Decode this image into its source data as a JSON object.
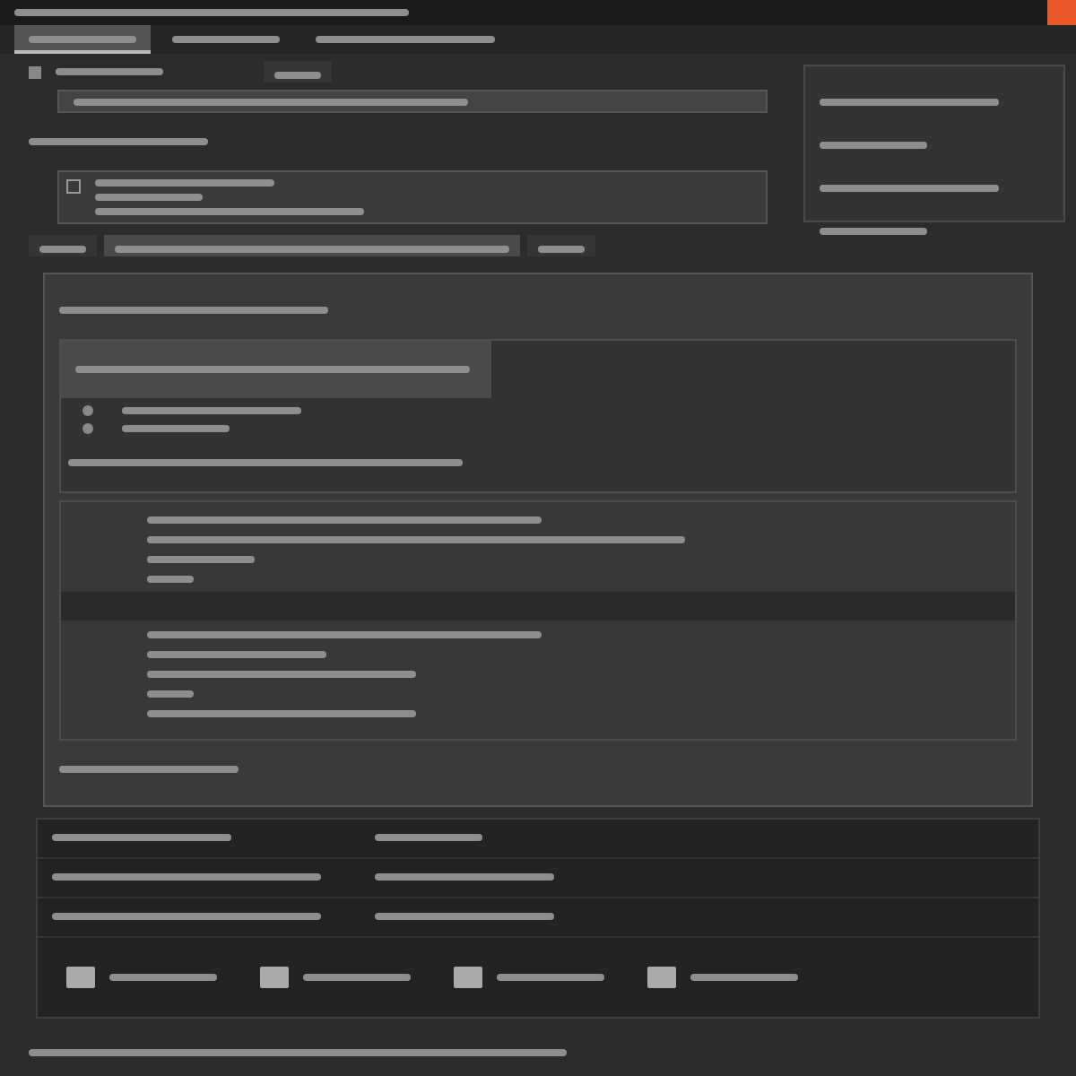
{
  "title_bar": {
    "text": {
      "kind": "xl"
    },
    "badge": {
      "kind": "alert"
    }
  },
  "tabs": [
    {
      "kind": "s",
      "selected": true
    },
    {
      "kind": "s",
      "selected": false
    },
    {
      "kind": "m",
      "selected": false
    }
  ],
  "header": {
    "text": {
      "kind": "s"
    },
    "button": {
      "kind": "xs"
    }
  },
  "search": {
    "text": {
      "kind": "xl"
    }
  },
  "note": {
    "kind": "m"
  },
  "task_card": {
    "checked": false,
    "lines": [
      {
        "kind": "m"
      },
      {
        "kind": "s"
      },
      {
        "kind": "l"
      }
    ]
  },
  "sub_tabs": [
    {
      "kind": "xs",
      "selected": false
    },
    {
      "kind": "xl",
      "selected": true
    },
    {
      "kind": "xs",
      "selected": false
    }
  ],
  "side_panel": {
    "items": [
      {
        "kind": "m"
      },
      {
        "kind": "s"
      },
      {
        "kind": "m"
      },
      {
        "kind": "s"
      }
    ]
  },
  "editor": {
    "heading": {
      "kind": "l"
    },
    "selected_row": {
      "kind": "xl"
    },
    "list": [
      {
        "kind": "m"
      },
      {
        "kind": "s"
      }
    ],
    "footnote": {
      "kind": "xl"
    },
    "code_lines": [
      {
        "kind": "xl"
      },
      {
        "kind": "xxl"
      },
      {
        "kind": "s"
      },
      {
        "kind": "xs"
      },
      {
        "kind": "band"
      },
      {
        "kind": "xl"
      },
      {
        "kind": "m"
      },
      {
        "kind": "l"
      },
      {
        "kind": "xs"
      },
      {
        "kind": "l"
      }
    ],
    "bottom_note": {
      "kind": "m"
    }
  },
  "details": {
    "rows": [
      {
        "cells": [
          {
            "kind": "m"
          },
          {
            "kind": "s"
          }
        ]
      },
      {
        "cells": [
          {
            "kind": "l"
          },
          {
            "kind": "m"
          }
        ]
      },
      {
        "cells": [
          {
            "kind": "l"
          },
          {
            "kind": "m"
          }
        ]
      }
    ]
  },
  "attachments": [
    {
      "kind": "s"
    },
    {
      "kind": "s"
    },
    {
      "kind": "s"
    },
    {
      "kind": "s"
    }
  ],
  "status_bar": {
    "kind": "xxl"
  }
}
